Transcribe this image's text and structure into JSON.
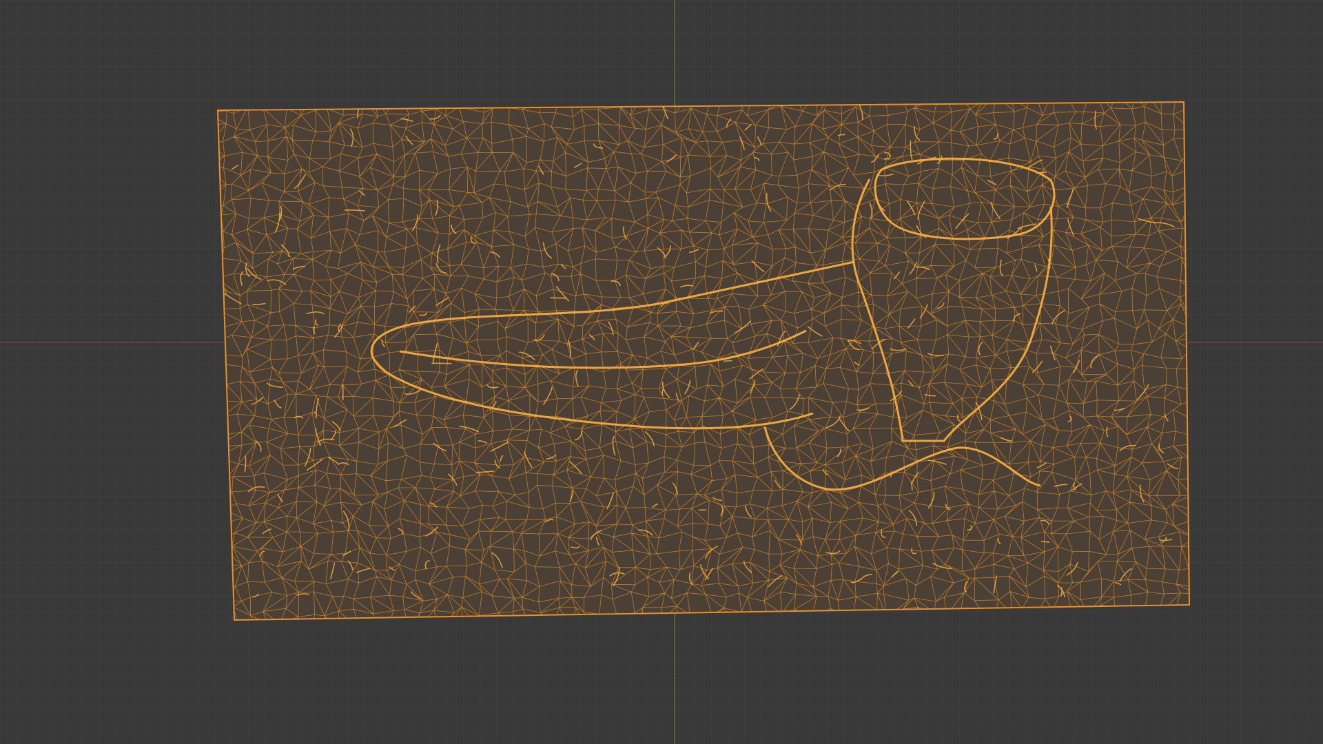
{
  "viewport": {
    "background_color": "#393939",
    "grid_color": "#434343",
    "x_axis_color": "#7a4545",
    "y_axis_color": "#6b7b3a",
    "wire_color": "#e8902a",
    "wire_bright_color": "#ffb040",
    "mesh_fill_color": "#4a4035"
  }
}
